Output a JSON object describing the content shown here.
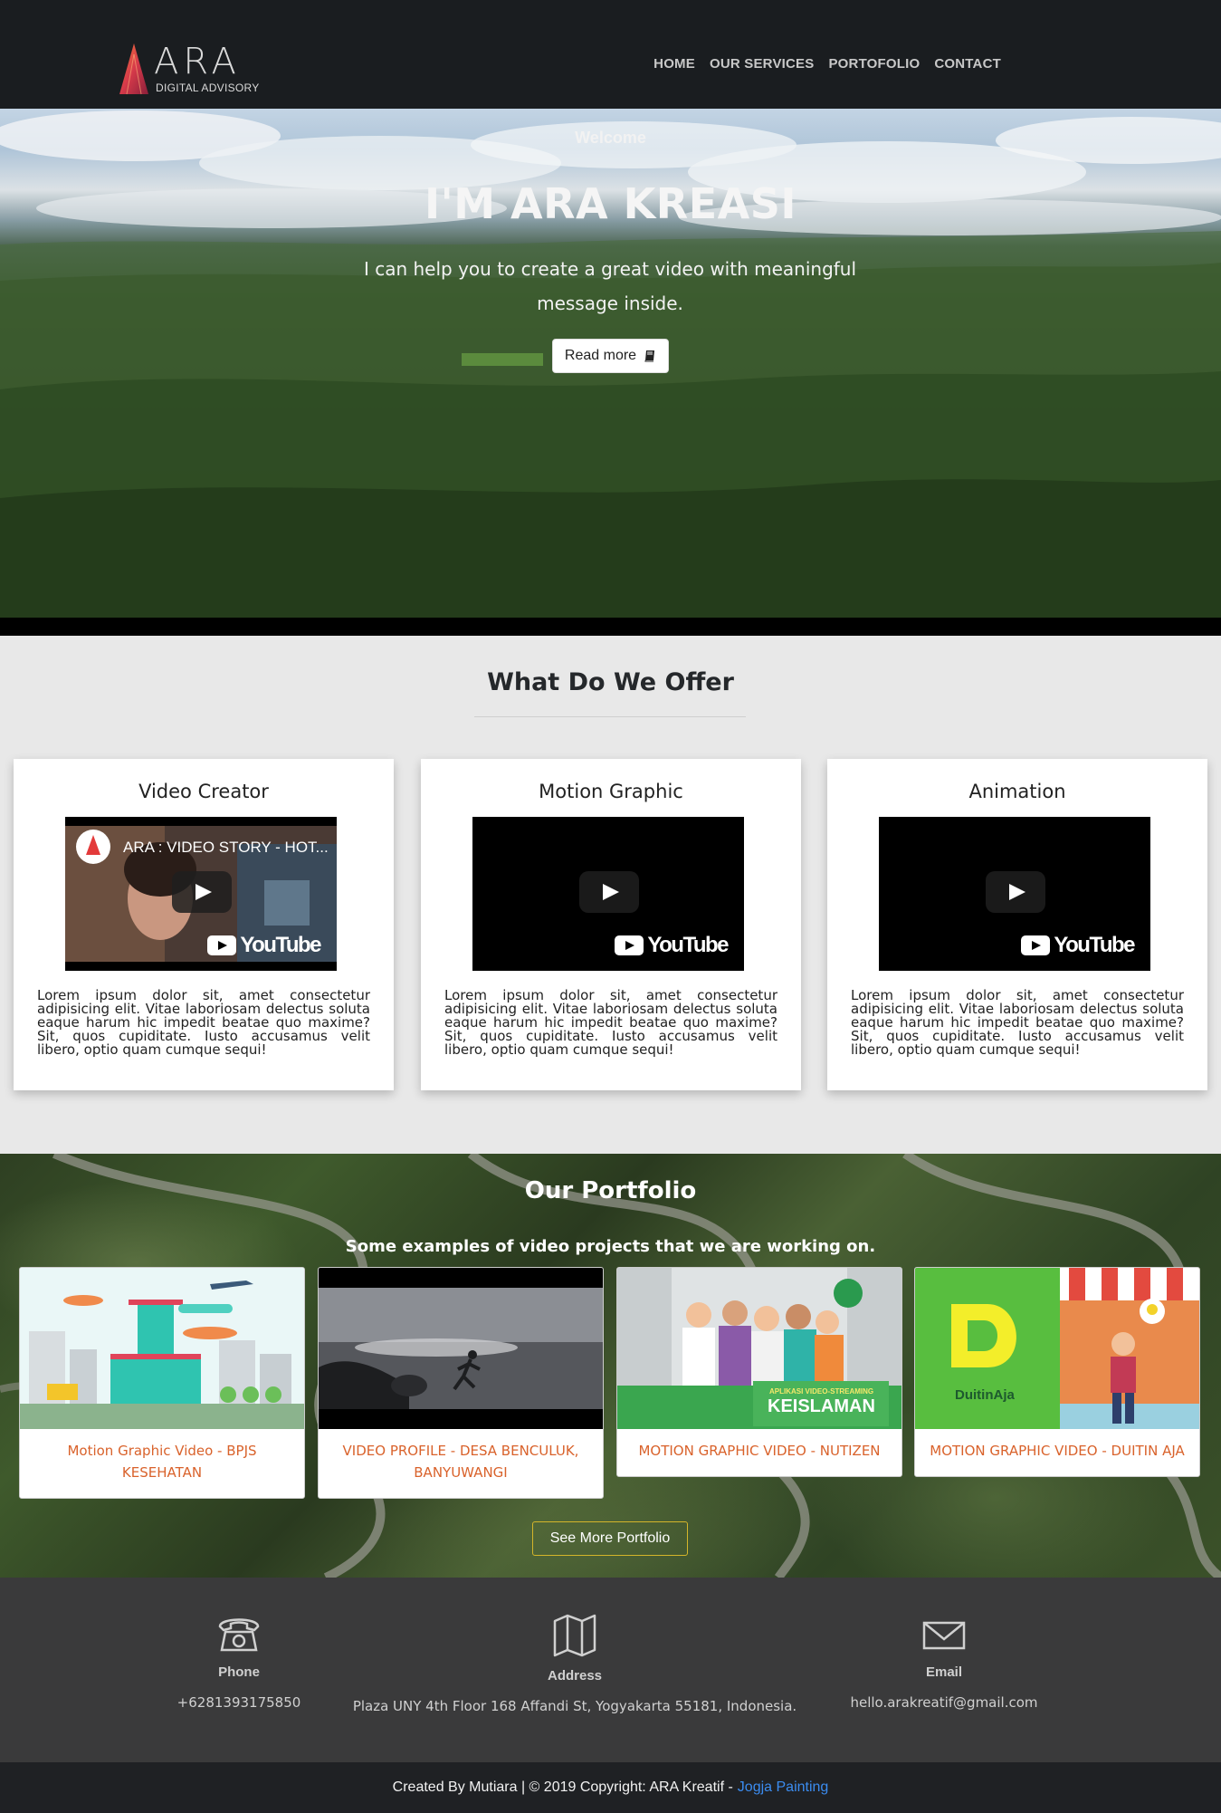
{
  "brand": {
    "logo_word": "ARA",
    "logo_sub": "DIGITAL ADVISORY"
  },
  "nav": {
    "items": [
      {
        "label": "HOME"
      },
      {
        "label": "OUR SERVICES"
      },
      {
        "label": "PORTOFOLIO"
      },
      {
        "label": "CONTACT"
      }
    ]
  },
  "hero": {
    "welcome": "Welcome",
    "title": "I'M ARA KREASI",
    "description": "I can help you to create a great video with meaningful message inside.",
    "button_label": "Read more",
    "button_icon": "book-icon"
  },
  "offer": {
    "title": "What Do We Offer",
    "cards": [
      {
        "title": "Video Creator",
        "video_title": "ARA : VIDEO STORY - HOT...",
        "text": "Lorem ipsum dolor sit, amet consectetur adipisicing elit. Vitae laboriosam delectus soluta eaque harum hic impedit beatae quo maxime? Sit, quos cupiditate. Iusto accusamus velit libero, optio quam cumque sequi!"
      },
      {
        "title": "Motion Graphic",
        "video_title": "",
        "text": "Lorem ipsum dolor sit, amet consectetur adipisicing elit. Vitae laboriosam delectus soluta eaque harum hic impedit beatae quo maxime? Sit, quos cupiditate. Iusto accusamus velit libero, optio quam cumque sequi!"
      },
      {
        "title": "Animation",
        "video_title": "",
        "text": "Lorem ipsum dolor sit, amet consectetur adipisicing elit. Vitae laboriosam delectus soluta eaque harum hic impedit beatae quo maxime? Sit, quos cupiditate. Iusto accusamus velit libero, optio quam cumque sequi!"
      }
    ],
    "youtube_word": "YouTube"
  },
  "portfolio": {
    "title": "Our Portfolio",
    "subtitle": "Some examples of video projects that we are working on.",
    "items": [
      {
        "caption": "Motion Graphic Video - BPJS KESEHATAN"
      },
      {
        "caption": "VIDEO PROFILE - DESA BENCULUK, BANYUWANGI"
      },
      {
        "caption": "MOTION GRAPHIC VIDEO - NUTIZEN",
        "thumb_text_1": "APLIKASI VIDEO-STREAMING",
        "thumb_text_2": "KEISLAMAN"
      },
      {
        "caption": "MOTION GRAPHIC VIDEO - DUITIN AJA",
        "thumb_text_1": "DuitinAja"
      }
    ],
    "button_label": "See More Portfolio"
  },
  "contact": {
    "phone": {
      "label": "Phone",
      "value": "+6281393175850"
    },
    "address": {
      "label": "Address",
      "value": "Plaza UNY 4th Floor 168 Affandi St, Yogyakarta 55181, Indonesia."
    },
    "email": {
      "label": "Email",
      "value": "hello.arakreatif@gmail.com"
    }
  },
  "footer": {
    "text": "Created By Mutiara | © 2019 Copyright: ARA Kreatif -",
    "link": "Jogja Painting"
  },
  "colors": {
    "nav_bg": "#1a1d20",
    "accent_orange": "#d9622b",
    "link_blue": "#3b8cf0",
    "button_gold": "#d4b52a",
    "contact_bg": "#3a3a3b"
  }
}
